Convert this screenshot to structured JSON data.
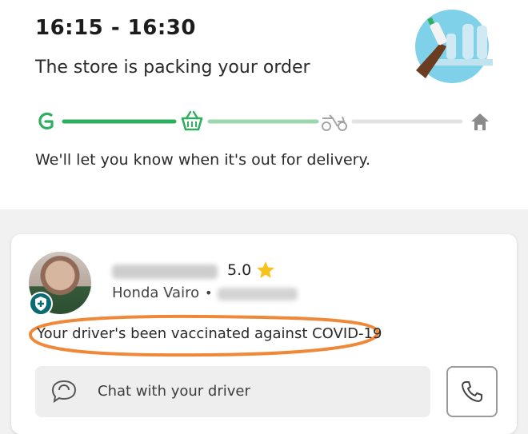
{
  "status": {
    "eta_window": "16:15 - 16:30",
    "headline": "The store is packing your order",
    "note": "We'll let you know when it's out for delivery.",
    "progress_steps": [
      "grab-logo-icon",
      "basket-icon",
      "scooter-icon",
      "home-icon"
    ],
    "current_step": 1
  },
  "driver": {
    "rating": "5.0",
    "vehicle": "Honda Vairo",
    "separator": "•",
    "vaccination_note": "Your driver's been vaccinated against COVID-19"
  },
  "actions": {
    "chat_label": "Chat with your driver"
  },
  "colors": {
    "brand_green": "#2fae5f",
    "track_light_green": "#9bd8ae",
    "track_grey": "#e3e3e3",
    "star_yellow": "#f6c21c",
    "annotation_orange": "#f0883a"
  }
}
